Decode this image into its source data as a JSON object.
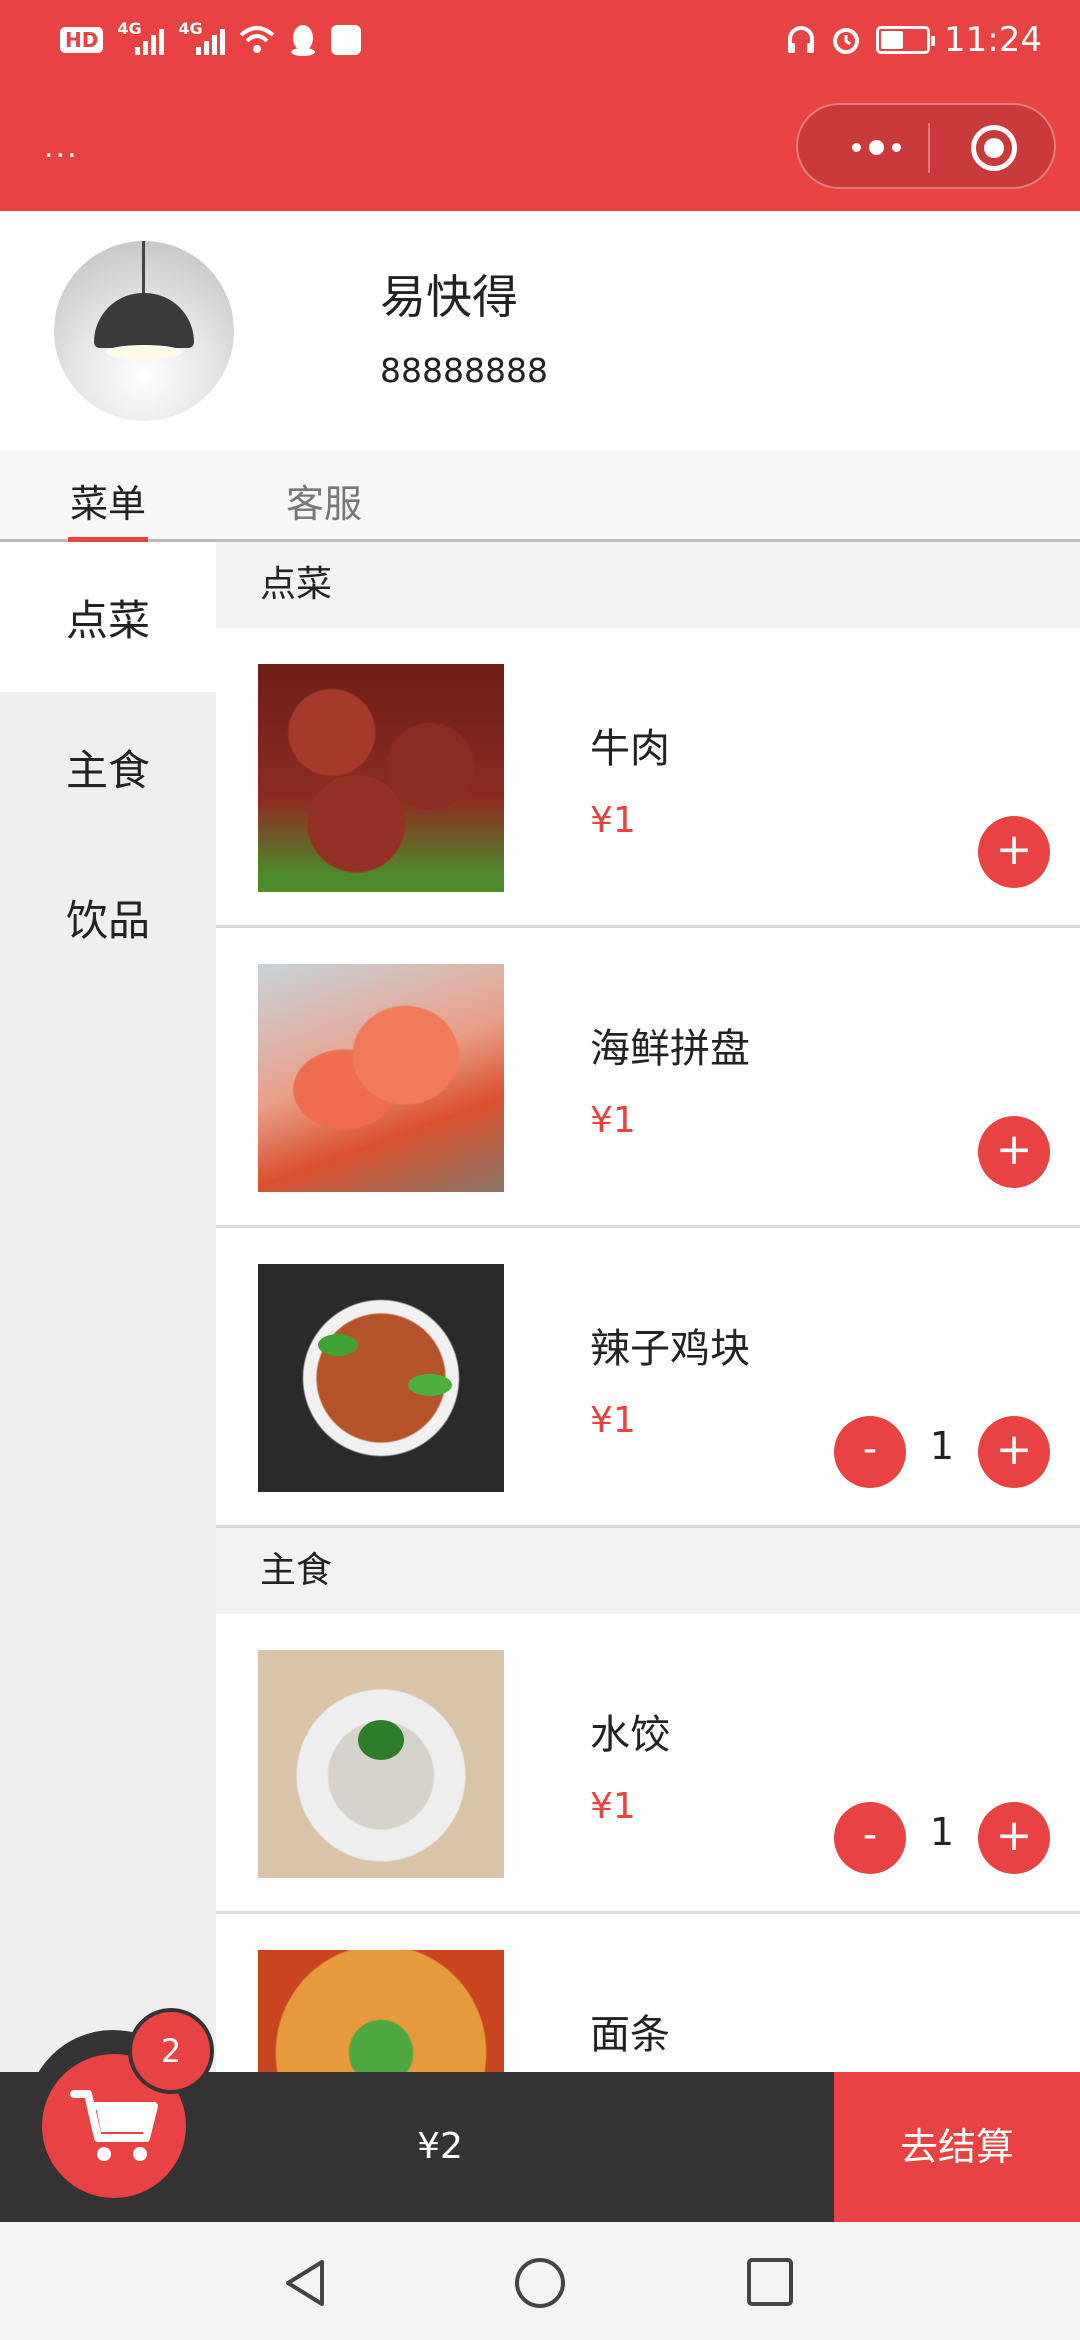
{
  "status_bar": {
    "left_badge": "HD",
    "signal_labels": [
      "4G",
      "4G"
    ],
    "time": "11:24"
  },
  "title_bar": {
    "more_label": "...",
    "capsule_more_icon": "more-dots-icon",
    "capsule_close_icon": "target-icon"
  },
  "shop": {
    "name": "易快得",
    "phone": "88888888"
  },
  "tabs": [
    {
      "label": "菜单",
      "active": true
    },
    {
      "label": "客服",
      "active": false
    }
  ],
  "categories": [
    {
      "label": "点菜",
      "active": true
    },
    {
      "label": "主食",
      "active": false
    },
    {
      "label": "饮品",
      "active": false
    }
  ],
  "sections": [
    {
      "title": "点菜",
      "items": [
        {
          "name": "牛肉",
          "price": "¥1",
          "qty": ""
        },
        {
          "name": "海鲜拼盘",
          "price": "¥1",
          "qty": ""
        },
        {
          "name": "辣子鸡块",
          "price": "¥1",
          "qty": "1"
        }
      ]
    },
    {
      "title": "主食",
      "items": [
        {
          "name": "水饺",
          "price": "¥1",
          "qty": "1"
        },
        {
          "name": "面条",
          "price": "",
          "qty": ""
        }
      ]
    }
  ],
  "buttons": {
    "plus": "+",
    "minus": "-"
  },
  "cart": {
    "count": "2",
    "total": "¥2",
    "checkout_label": "去结算"
  },
  "colors": {
    "accent": "#e84242",
    "cart_bar": "#343434"
  }
}
